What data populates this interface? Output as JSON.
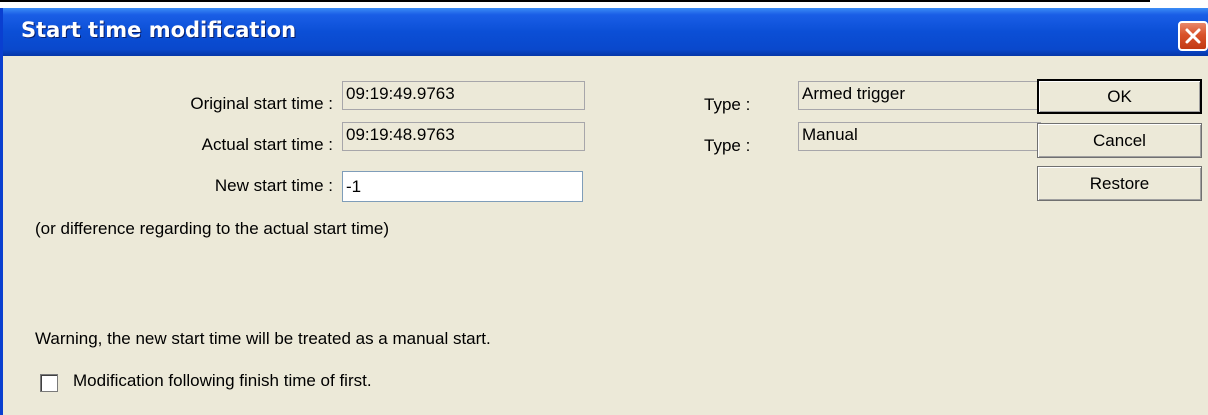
{
  "window": {
    "title": "Start time modification"
  },
  "fields": {
    "original_start": {
      "label": "Original start time :",
      "value": "09:19:49.9763"
    },
    "actual_start": {
      "label": "Actual start time :",
      "value": "09:19:48.9763"
    },
    "new_start": {
      "label": "New start time :",
      "value": "-1"
    },
    "type_original": {
      "label": "Type :",
      "value": "Armed trigger"
    },
    "type_actual": {
      "label": "Type :",
      "value": "Manual"
    }
  },
  "hint": "(or difference regarding to the actual start time)",
  "warning": "Warning, the new start time will be treated as a manual start.",
  "checkbox": {
    "label": "Modification following finish time of first.",
    "checked": false
  },
  "buttons": {
    "ok": "OK",
    "cancel": "Cancel",
    "restore": "Restore"
  },
  "colors": {
    "titlebar": "#0b4fd6",
    "dialog_bg": "#ece9d8",
    "close_button": "#d9522a"
  }
}
